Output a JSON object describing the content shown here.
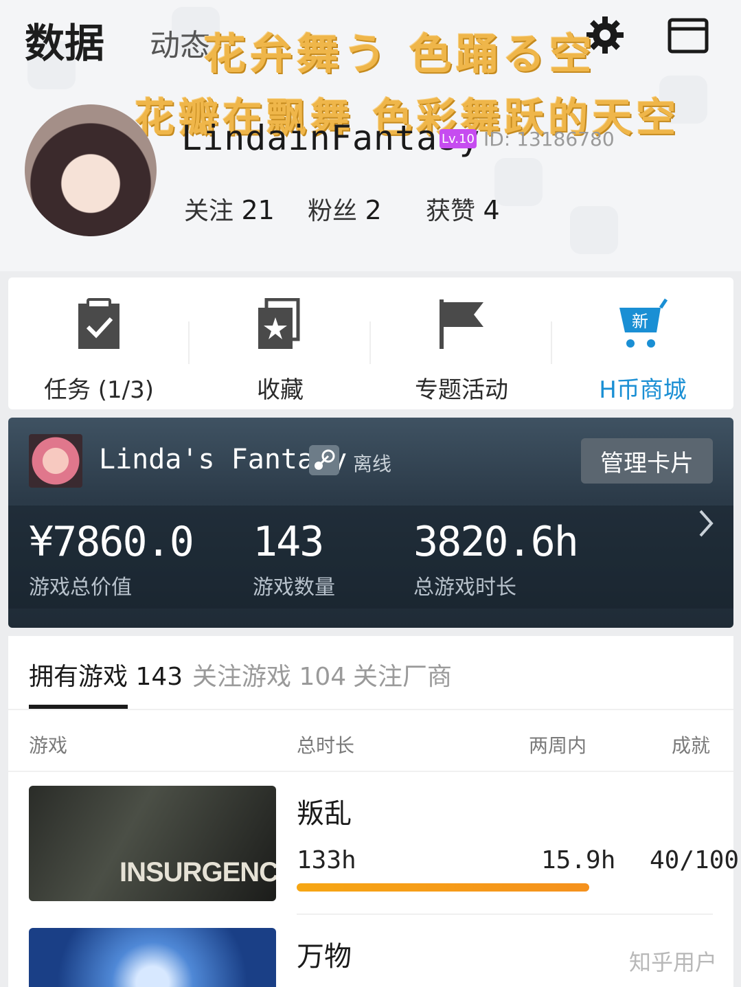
{
  "top_tabs": {
    "data": "数据",
    "feed": "动态"
  },
  "overlay": {
    "line1": "花弁舞う 色踊る空",
    "line2": "花瓣在飘舞 色彩舞跃的天空"
  },
  "profile": {
    "username": "LindainFantasy",
    "level": "Lv.10",
    "id_text": "ID: 13186780",
    "follow_label": "关注",
    "follow_count": "21",
    "fans_label": "粉丝",
    "fans_count": "2",
    "likes_label": "获赞",
    "likes_count": "4"
  },
  "quick_actions": [
    {
      "label": "任务 (1/3)",
      "icon": "clipboard-check-icon"
    },
    {
      "label": "收藏",
      "icon": "star-bookmark-icon"
    },
    {
      "label": "专题活动",
      "icon": "flag-icon"
    },
    {
      "label": "H币商城",
      "icon": "cart-new-icon",
      "badge": "新"
    }
  ],
  "steam": {
    "name": "Linda's Fantasy",
    "status": "离线",
    "manage_label": "管理卡片",
    "metrics": [
      {
        "value": "¥7860.0",
        "label": "游戏总价值"
      },
      {
        "value": "143",
        "label": "游戏数量"
      },
      {
        "value": "3820.6h",
        "label": "总游戏时长"
      }
    ]
  },
  "game_tabs": [
    {
      "label": "拥有游戏 143",
      "active": true
    },
    {
      "label": "关注游戏 104",
      "active": false
    },
    {
      "label": "关注厂商",
      "active": false
    }
  ],
  "columns": {
    "game": "游戏",
    "total": "总时长",
    "two_weeks": "两周内",
    "achievements": "成就"
  },
  "games": [
    {
      "title": "叛乱",
      "thumb_text": "INSURGENCY",
      "total": "133h",
      "two_weeks": "15.9h",
      "achievements": "40/100",
      "progress": 1.0
    },
    {
      "title": "万物"
    }
  ],
  "watermark": "知乎用户",
  "colors": {
    "accent": "#1a8fd4",
    "level_badge": "#c64cf0",
    "progress": "#f6a614",
    "overlay_text": "#efb64a"
  }
}
